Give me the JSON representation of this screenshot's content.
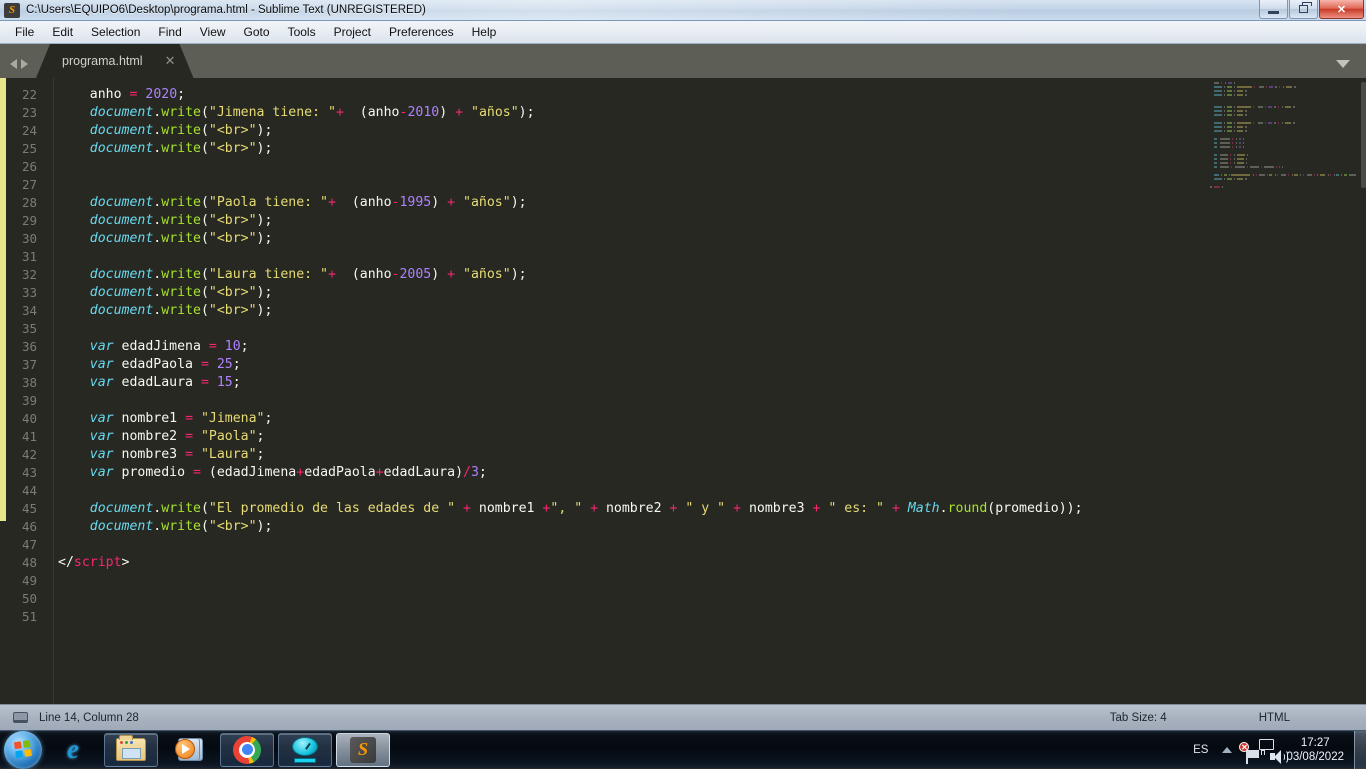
{
  "window": {
    "title": "C:\\Users\\EQUIPO6\\Desktop\\programa.html - Sublime Text (UNREGISTERED)",
    "app_icon_glyph": "S",
    "controls": {
      "minimize": "minimize-icon",
      "restore": "restore-icon",
      "close": "✕"
    }
  },
  "menubar": {
    "items": [
      {
        "label": "File"
      },
      {
        "label": "Edit"
      },
      {
        "label": "Selection"
      },
      {
        "label": "Find"
      },
      {
        "label": "View"
      },
      {
        "label": "Goto"
      },
      {
        "label": "Tools"
      },
      {
        "label": "Project"
      },
      {
        "label": "Preferences"
      },
      {
        "label": "Help"
      }
    ]
  },
  "tabbar": {
    "nav_prev": "prev-tab-arrow",
    "nav_next": "next-tab-arrow",
    "tabs": [
      {
        "label": "programa.html",
        "close_glyph": "✕",
        "active": true
      }
    ],
    "overflow_glyph": "chevron-down"
  },
  "editor": {
    "first_line_number": 22,
    "last_line_number": 51,
    "line_numbers": [
      22,
      23,
      24,
      25,
      26,
      27,
      28,
      29,
      30,
      31,
      32,
      33,
      34,
      35,
      36,
      37,
      38,
      39,
      40,
      41,
      42,
      43,
      44,
      45,
      46,
      47,
      48,
      49,
      50,
      51
    ],
    "theme_colors": {
      "background": "#272822",
      "gutter_text": "#7b7d74",
      "plain": "#f8f8f2",
      "keyword": "#66d9ef",
      "function": "#a6e22e",
      "string": "#e6db74",
      "number": "#ae81ff",
      "operator": "#f92672",
      "modified_bar": "#e6e68a"
    },
    "lines": [
      {
        "n": 22,
        "tokens": [
          {
            "t": "    ",
            "c": "pln"
          },
          {
            "t": "anho ",
            "c": "pln"
          },
          {
            "t": "=",
            "c": "op"
          },
          {
            "t": " ",
            "c": "pln"
          },
          {
            "t": "2020",
            "c": "num"
          },
          {
            "t": ";",
            "c": "pln"
          }
        ]
      },
      {
        "n": 23,
        "tokens": [
          {
            "t": "    ",
            "c": "pln"
          },
          {
            "t": "document",
            "c": "var"
          },
          {
            "t": ".",
            "c": "pln"
          },
          {
            "t": "write",
            "c": "fn"
          },
          {
            "t": "(",
            "c": "pln"
          },
          {
            "t": "\"Jimena tiene: \"",
            "c": "str"
          },
          {
            "t": "+",
            "c": "op"
          },
          {
            "t": "  (anho",
            "c": "pln"
          },
          {
            "t": "-",
            "c": "op"
          },
          {
            "t": "2010",
            "c": "num"
          },
          {
            "t": ") ",
            "c": "pln"
          },
          {
            "t": "+",
            "c": "op"
          },
          {
            "t": " ",
            "c": "pln"
          },
          {
            "t": "\"años\"",
            "c": "str"
          },
          {
            "t": ");",
            "c": "pln"
          }
        ]
      },
      {
        "n": 24,
        "tokens": [
          {
            "t": "    ",
            "c": "pln"
          },
          {
            "t": "document",
            "c": "var"
          },
          {
            "t": ".",
            "c": "pln"
          },
          {
            "t": "write",
            "c": "fn"
          },
          {
            "t": "(",
            "c": "pln"
          },
          {
            "t": "\"<br>\"",
            "c": "str"
          },
          {
            "t": ");",
            "c": "pln"
          }
        ]
      },
      {
        "n": 25,
        "tokens": [
          {
            "t": "    ",
            "c": "pln"
          },
          {
            "t": "document",
            "c": "var"
          },
          {
            "t": ".",
            "c": "pln"
          },
          {
            "t": "write",
            "c": "fn"
          },
          {
            "t": "(",
            "c": "pln"
          },
          {
            "t": "\"<br>\"",
            "c": "str"
          },
          {
            "t": ");",
            "c": "pln"
          }
        ]
      },
      {
        "n": 26,
        "tokens": []
      },
      {
        "n": 27,
        "tokens": []
      },
      {
        "n": 28,
        "tokens": [
          {
            "t": "    ",
            "c": "pln"
          },
          {
            "t": "document",
            "c": "var"
          },
          {
            "t": ".",
            "c": "pln"
          },
          {
            "t": "write",
            "c": "fn"
          },
          {
            "t": "(",
            "c": "pln"
          },
          {
            "t": "\"Paola tiene: \"",
            "c": "str"
          },
          {
            "t": "+",
            "c": "op"
          },
          {
            "t": "  (anho",
            "c": "pln"
          },
          {
            "t": "-",
            "c": "op"
          },
          {
            "t": "1995",
            "c": "num"
          },
          {
            "t": ") ",
            "c": "pln"
          },
          {
            "t": "+",
            "c": "op"
          },
          {
            "t": " ",
            "c": "pln"
          },
          {
            "t": "\"años\"",
            "c": "str"
          },
          {
            "t": ");",
            "c": "pln"
          }
        ]
      },
      {
        "n": 29,
        "tokens": [
          {
            "t": "    ",
            "c": "pln"
          },
          {
            "t": "document",
            "c": "var"
          },
          {
            "t": ".",
            "c": "pln"
          },
          {
            "t": "write",
            "c": "fn"
          },
          {
            "t": "(",
            "c": "pln"
          },
          {
            "t": "\"<br>\"",
            "c": "str"
          },
          {
            "t": ");",
            "c": "pln"
          }
        ]
      },
      {
        "n": 30,
        "tokens": [
          {
            "t": "    ",
            "c": "pln"
          },
          {
            "t": "document",
            "c": "var"
          },
          {
            "t": ".",
            "c": "pln"
          },
          {
            "t": "write",
            "c": "fn"
          },
          {
            "t": "(",
            "c": "pln"
          },
          {
            "t": "\"<br>\"",
            "c": "str"
          },
          {
            "t": ");",
            "c": "pln"
          }
        ]
      },
      {
        "n": 31,
        "tokens": []
      },
      {
        "n": 32,
        "tokens": [
          {
            "t": "    ",
            "c": "pln"
          },
          {
            "t": "document",
            "c": "var"
          },
          {
            "t": ".",
            "c": "pln"
          },
          {
            "t": "write",
            "c": "fn"
          },
          {
            "t": "(",
            "c": "pln"
          },
          {
            "t": "\"Laura tiene: \"",
            "c": "str"
          },
          {
            "t": "+",
            "c": "op"
          },
          {
            "t": "  (anho",
            "c": "pln"
          },
          {
            "t": "-",
            "c": "op"
          },
          {
            "t": "2005",
            "c": "num"
          },
          {
            "t": ") ",
            "c": "pln"
          },
          {
            "t": "+",
            "c": "op"
          },
          {
            "t": " ",
            "c": "pln"
          },
          {
            "t": "\"años\"",
            "c": "str"
          },
          {
            "t": ");",
            "c": "pln"
          }
        ]
      },
      {
        "n": 33,
        "tokens": [
          {
            "t": "    ",
            "c": "pln"
          },
          {
            "t": "document",
            "c": "var"
          },
          {
            "t": ".",
            "c": "pln"
          },
          {
            "t": "write",
            "c": "fn"
          },
          {
            "t": "(",
            "c": "pln"
          },
          {
            "t": "\"<br>\"",
            "c": "str"
          },
          {
            "t": ");",
            "c": "pln"
          }
        ]
      },
      {
        "n": 34,
        "tokens": [
          {
            "t": "    ",
            "c": "pln"
          },
          {
            "t": "document",
            "c": "var"
          },
          {
            "t": ".",
            "c": "pln"
          },
          {
            "t": "write",
            "c": "fn"
          },
          {
            "t": "(",
            "c": "pln"
          },
          {
            "t": "\"<br>\"",
            "c": "str"
          },
          {
            "t": ");",
            "c": "pln"
          }
        ]
      },
      {
        "n": 35,
        "tokens": []
      },
      {
        "n": 36,
        "tokens": [
          {
            "t": "    ",
            "c": "pln"
          },
          {
            "t": "var",
            "c": "var"
          },
          {
            "t": " edadJimena ",
            "c": "pln"
          },
          {
            "t": "=",
            "c": "op"
          },
          {
            "t": " ",
            "c": "pln"
          },
          {
            "t": "10",
            "c": "num"
          },
          {
            "t": ";",
            "c": "pln"
          }
        ]
      },
      {
        "n": 37,
        "tokens": [
          {
            "t": "    ",
            "c": "pln"
          },
          {
            "t": "var",
            "c": "var"
          },
          {
            "t": " edadPaola ",
            "c": "pln"
          },
          {
            "t": "=",
            "c": "op"
          },
          {
            "t": " ",
            "c": "pln"
          },
          {
            "t": "25",
            "c": "num"
          },
          {
            "t": ";",
            "c": "pln"
          }
        ]
      },
      {
        "n": 38,
        "tokens": [
          {
            "t": "    ",
            "c": "pln"
          },
          {
            "t": "var",
            "c": "var"
          },
          {
            "t": " edadLaura ",
            "c": "pln"
          },
          {
            "t": "=",
            "c": "op"
          },
          {
            "t": " ",
            "c": "pln"
          },
          {
            "t": "15",
            "c": "num"
          },
          {
            "t": ";",
            "c": "pln"
          }
        ]
      },
      {
        "n": 39,
        "tokens": []
      },
      {
        "n": 40,
        "tokens": [
          {
            "t": "    ",
            "c": "pln"
          },
          {
            "t": "var",
            "c": "var"
          },
          {
            "t": " nombre1 ",
            "c": "pln"
          },
          {
            "t": "=",
            "c": "op"
          },
          {
            "t": " ",
            "c": "pln"
          },
          {
            "t": "\"Jimena\"",
            "c": "str"
          },
          {
            "t": ";",
            "c": "pln"
          }
        ]
      },
      {
        "n": 41,
        "tokens": [
          {
            "t": "    ",
            "c": "pln"
          },
          {
            "t": "var",
            "c": "var"
          },
          {
            "t": " nombre2 ",
            "c": "pln"
          },
          {
            "t": "=",
            "c": "op"
          },
          {
            "t": " ",
            "c": "pln"
          },
          {
            "t": "\"Paola\"",
            "c": "str"
          },
          {
            "t": ";",
            "c": "pln"
          }
        ]
      },
      {
        "n": 42,
        "tokens": [
          {
            "t": "    ",
            "c": "pln"
          },
          {
            "t": "var",
            "c": "var"
          },
          {
            "t": " nombre3 ",
            "c": "pln"
          },
          {
            "t": "=",
            "c": "op"
          },
          {
            "t": " ",
            "c": "pln"
          },
          {
            "t": "\"Laura\"",
            "c": "str"
          },
          {
            "t": ";",
            "c": "pln"
          }
        ]
      },
      {
        "n": 43,
        "tokens": [
          {
            "t": "    ",
            "c": "pln"
          },
          {
            "t": "var",
            "c": "var"
          },
          {
            "t": " promedio ",
            "c": "pln"
          },
          {
            "t": "=",
            "c": "op"
          },
          {
            "t": " (edadJimena",
            "c": "pln"
          },
          {
            "t": "+",
            "c": "op"
          },
          {
            "t": "edadPaola",
            "c": "pln"
          },
          {
            "t": "+",
            "c": "op"
          },
          {
            "t": "edadLaura)",
            "c": "pln"
          },
          {
            "t": "/",
            "c": "op"
          },
          {
            "t": "3",
            "c": "num"
          },
          {
            "t": ";",
            "c": "pln"
          }
        ]
      },
      {
        "n": 44,
        "tokens": []
      },
      {
        "n": 45,
        "tokens": [
          {
            "t": "    ",
            "c": "pln"
          },
          {
            "t": "document",
            "c": "var"
          },
          {
            "t": ".",
            "c": "pln"
          },
          {
            "t": "write",
            "c": "fn"
          },
          {
            "t": "(",
            "c": "pln"
          },
          {
            "t": "\"El promedio de las edades de \"",
            "c": "str"
          },
          {
            "t": " ",
            "c": "pln"
          },
          {
            "t": "+",
            "c": "op"
          },
          {
            "t": " nombre1 ",
            "c": "pln"
          },
          {
            "t": "+",
            "c": "op"
          },
          {
            "t": "\", \"",
            "c": "str"
          },
          {
            "t": " ",
            "c": "pln"
          },
          {
            "t": "+",
            "c": "op"
          },
          {
            "t": " nombre2 ",
            "c": "pln"
          },
          {
            "t": "+",
            "c": "op"
          },
          {
            "t": " ",
            "c": "pln"
          },
          {
            "t": "\" y \"",
            "c": "str"
          },
          {
            "t": " ",
            "c": "pln"
          },
          {
            "t": "+",
            "c": "op"
          },
          {
            "t": " nombre3 ",
            "c": "pln"
          },
          {
            "t": "+",
            "c": "op"
          },
          {
            "t": " ",
            "c": "pln"
          },
          {
            "t": "\" es: \"",
            "c": "str"
          },
          {
            "t": " ",
            "c": "pln"
          },
          {
            "t": "+",
            "c": "op"
          },
          {
            "t": " ",
            "c": "pln"
          },
          {
            "t": "Math",
            "c": "var"
          },
          {
            "t": ".",
            "c": "pln"
          },
          {
            "t": "round",
            "c": "fn"
          },
          {
            "t": "(promedio));",
            "c": "pln"
          }
        ]
      },
      {
        "n": 46,
        "tokens": [
          {
            "t": "    ",
            "c": "pln"
          },
          {
            "t": "document",
            "c": "var"
          },
          {
            "t": ".",
            "c": "pln"
          },
          {
            "t": "write",
            "c": "fn"
          },
          {
            "t": "(",
            "c": "pln"
          },
          {
            "t": "\"<br>\"",
            "c": "str"
          },
          {
            "t": ");",
            "c": "pln"
          }
        ]
      },
      {
        "n": 47,
        "tokens": []
      },
      {
        "n": 48,
        "tokens": [
          {
            "t": "</",
            "c": "pln"
          },
          {
            "t": "script",
            "c": "tag"
          },
          {
            "t": ">",
            "c": "pln"
          }
        ]
      },
      {
        "n": 49,
        "tokens": []
      },
      {
        "n": 50,
        "tokens": []
      },
      {
        "n": 51,
        "tokens": []
      }
    ]
  },
  "statusbar": {
    "left_icon": "panel-icon",
    "cursor_position": "Line 14, Column 28",
    "tab_size": "Tab Size: 4",
    "syntax": "HTML"
  },
  "taskbar": {
    "start_label": "start-orb",
    "buttons": [
      {
        "name": "internet-explorer",
        "glyph": "e",
        "state": "pinned"
      },
      {
        "name": "file-explorer",
        "glyph": "folder",
        "state": "running"
      },
      {
        "name": "media-player",
        "glyph": "media",
        "state": "pinned"
      },
      {
        "name": "google-chrome",
        "glyph": "chrome",
        "state": "running"
      },
      {
        "name": "disk-utility",
        "glyph": "clock",
        "state": "running"
      },
      {
        "name": "sublime-text",
        "glyph": "S",
        "state": "active"
      }
    ],
    "tray": {
      "language": "ES",
      "show_hidden": "show-hidden-icons",
      "icons": [
        "action-center-flag",
        "network-icon",
        "volume-icon"
      ],
      "time": "17:27",
      "date": "03/08/2022"
    }
  }
}
